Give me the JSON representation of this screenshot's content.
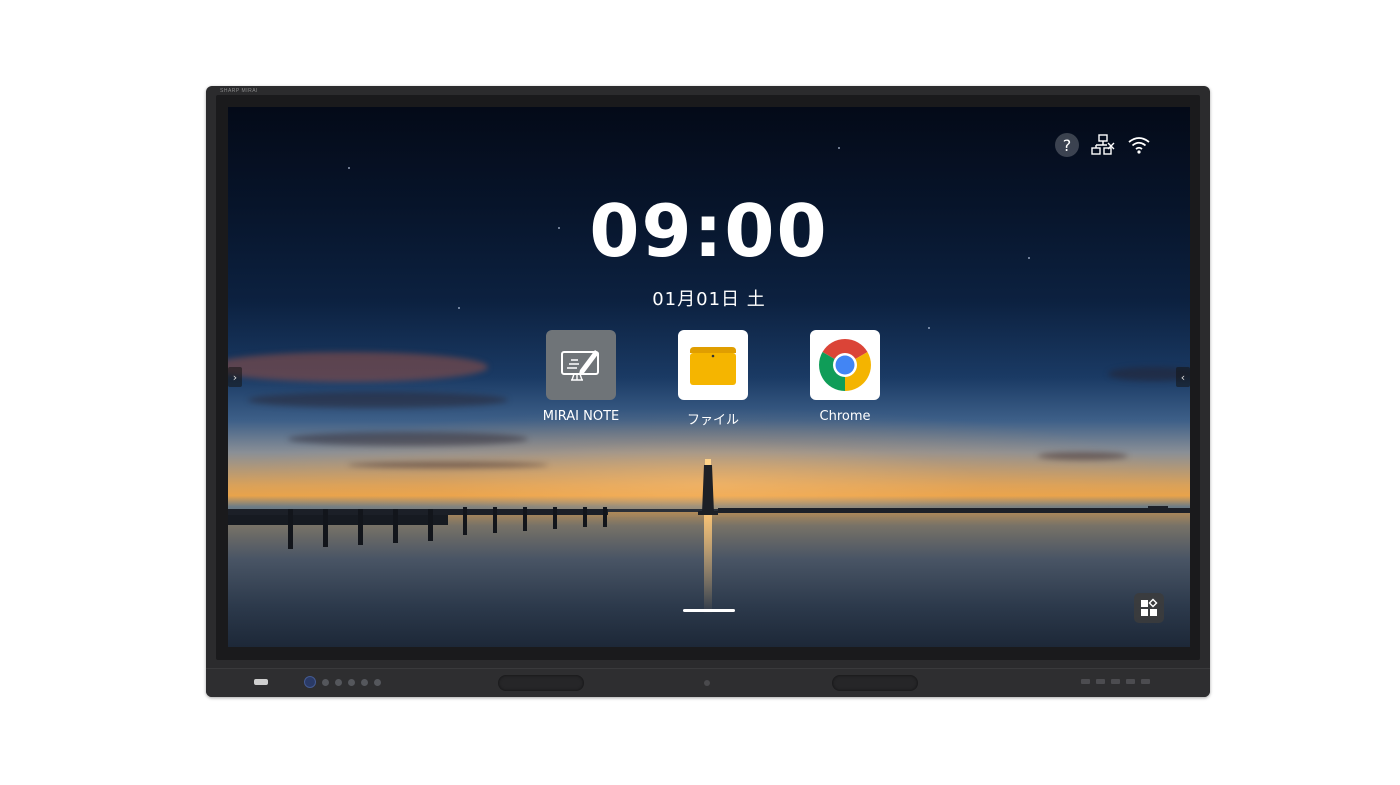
{
  "device": {
    "brand_text": "SHARP MIRAI"
  },
  "home": {
    "clock": "09:00",
    "date": "01月01日 土"
  },
  "status_icons": [
    {
      "name": "help",
      "glyph": "?"
    },
    {
      "name": "network-disconnected"
    },
    {
      "name": "wifi"
    }
  ],
  "apps": [
    {
      "label": "MIRAI NOTE",
      "icon": "whiteboard-pen-icon"
    },
    {
      "label": "ファイル",
      "icon": "folder-icon"
    },
    {
      "label": "Chrome",
      "icon": "chrome-icon"
    }
  ],
  "edge_arrows": {
    "left": "›",
    "right": "‹"
  },
  "colors": {
    "folder": "#f5b500",
    "mirai_tile": "#6f7478",
    "chrome_red": "#db4437",
    "chrome_green": "#0f9d58",
    "chrome_yellow": "#f4b400",
    "chrome_blue": "#4285f4"
  }
}
